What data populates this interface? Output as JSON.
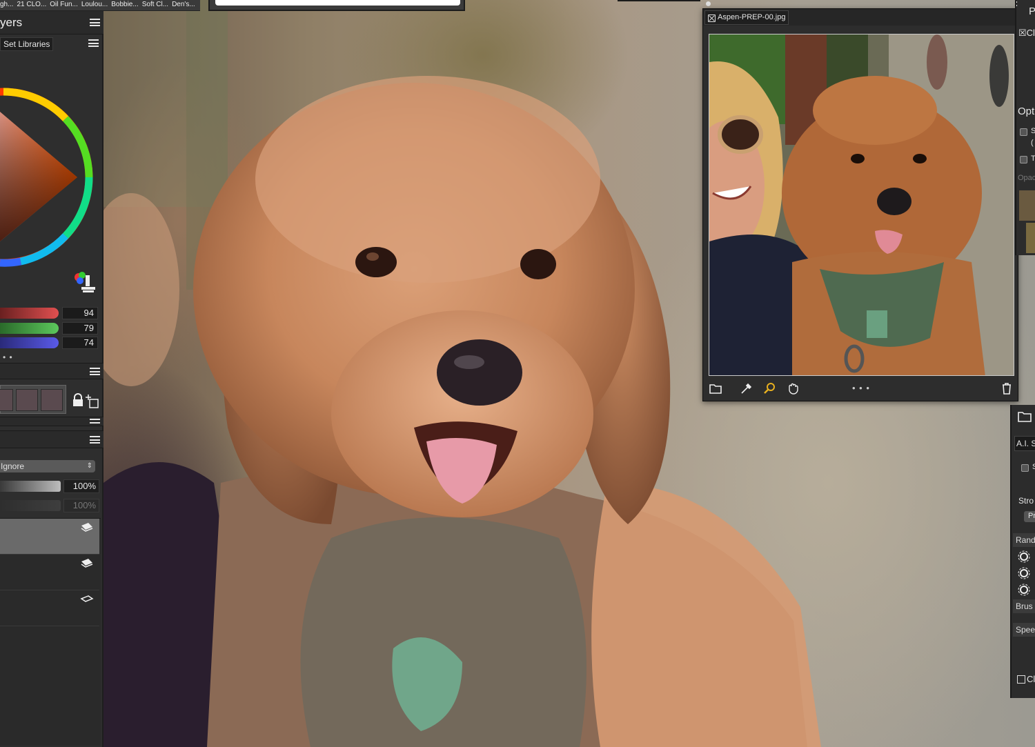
{
  "brush_library_tabs": [
    "gh...",
    "21 CLO...",
    "Oil Fun...",
    "Loulou...",
    "Bobbie...",
    "Soft Cl...",
    "Den's..."
  ],
  "left_panel": {
    "layers_title": "yers",
    "tab_label": "Set Libraries",
    "color_values": {
      "red": "94",
      "green": "79",
      "blue": "74"
    },
    "more_dots": "• •",
    "composite_method": "Ignore",
    "opacity_value": "100%",
    "grain_value": "100%"
  },
  "reference_panel": {
    "tab_label": "Aspen-PREP-00.jpg",
    "more_dots": "• • •"
  },
  "right_panel": {
    "top_label": "Cl",
    "heading_top": "P",
    "options_label": "Opt",
    "check1_label": "S",
    "check1_sub": "(",
    "check2_label": "T",
    "opacity_label": "Opac",
    "ai_label": "A.I. S",
    "check3_label": "S",
    "stroke_label": "Stro",
    "preset_label": "Pr",
    "random_label": "Rand",
    "brush_label": "Brus",
    "speed_label": "Spee",
    "close_label": "Cl"
  },
  "colors": {
    "accent_red": "#e05050",
    "accent_green": "#5cc85c",
    "accent_blue": "#5a5ae8",
    "panel_bg": "#2e2e2e"
  }
}
